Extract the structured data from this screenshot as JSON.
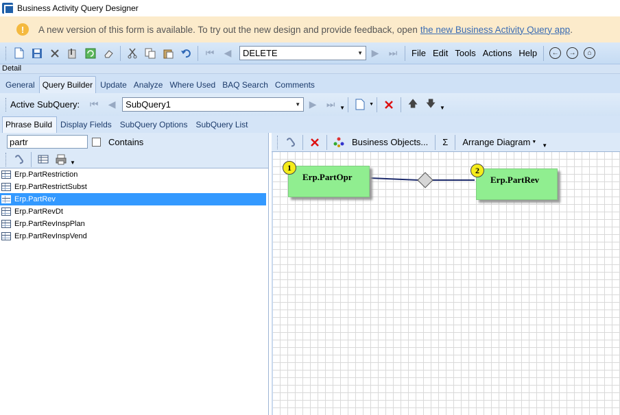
{
  "window": {
    "title": "Business Activity Query Designer"
  },
  "banner": {
    "text": "A new version of this form is available. To try out the new design and provide feedback, open",
    "link_text": "the new Business Activity Query app",
    "trailing": "."
  },
  "toolbar": {
    "query_id": "DELETE",
    "menus": [
      "File",
      "Edit",
      "Tools",
      "Actions",
      "Help"
    ]
  },
  "detail_label": "Detail",
  "main_tabs": [
    "General",
    "Query Builder",
    "Update",
    "Analyze",
    "Where Used",
    "BAQ Search",
    "Comments"
  ],
  "subquery": {
    "label": "Active SubQuery:",
    "value": "SubQuery1"
  },
  "sub_tabs": [
    "Phrase Build",
    "Display Fields",
    "SubQuery Options",
    "SubQuery List"
  ],
  "search": {
    "value": "partr",
    "contains_label": "Contains"
  },
  "tables": [
    "Erp.PartRestriction",
    "Erp.PartRestrictSubst",
    "Erp.PartRev",
    "Erp.PartRevDt",
    "Erp.PartRevInspPlan",
    "Erp.PartRevInspVend"
  ],
  "selected_table": "Erp.PartRev",
  "diagram_toolbar": {
    "business_objects": "Business Objects...",
    "sigma": "Σ",
    "arrange": "Arrange Diagram"
  },
  "diagram": {
    "nodes": [
      {
        "badge": "1",
        "label": "Erp.PartOpr"
      },
      {
        "badge": "2",
        "label": "Erp.PartRev"
      }
    ]
  },
  "colors": {
    "node_fill": "#90ee90",
    "badge_fill": "#f5ec1a",
    "selection": "#3399ff",
    "banner_bg": "#fcebcb"
  }
}
